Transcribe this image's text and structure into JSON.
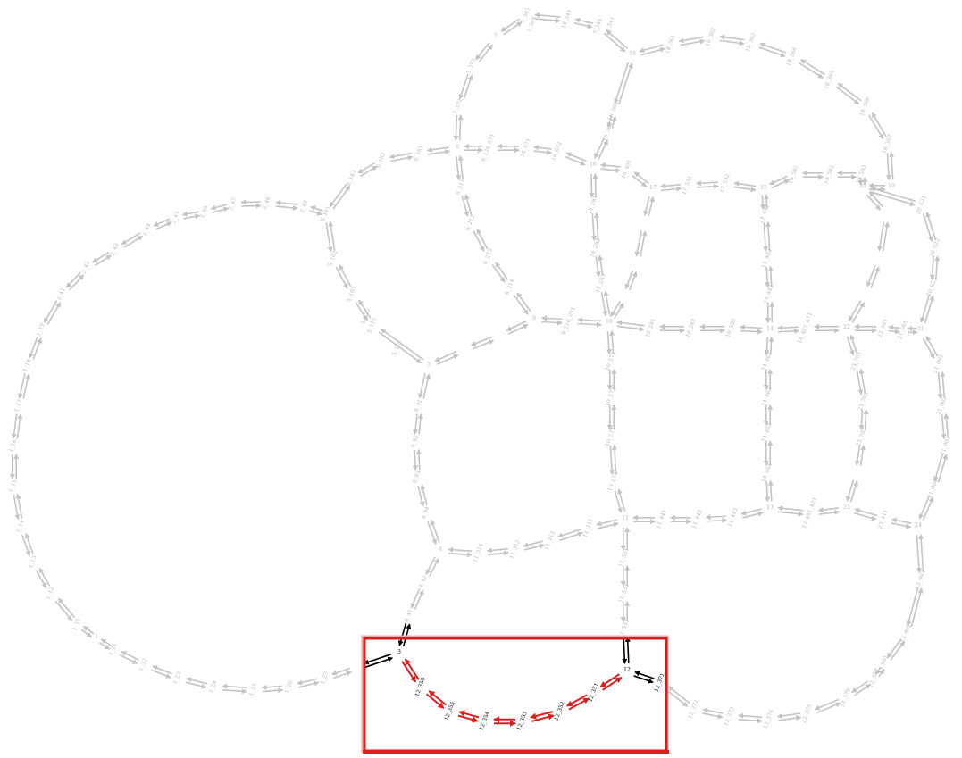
{
  "colors": {
    "inactive": "#c4c4c4",
    "active": "#000000",
    "highlight": "#dd1c1c"
  },
  "highlight_region": {
    "nodes": [
      "3",
      "12_356",
      "12_355",
      "12_354",
      "12_353",
      "12_352",
      "12_351",
      "12"
    ],
    "red_edges": [
      [
        "3",
        "12_356"
      ],
      [
        "12_356",
        "12_355"
      ],
      [
        "12_355",
        "12_354"
      ],
      [
        "12_354",
        "12_353"
      ],
      [
        "12_353",
        "12_352"
      ],
      [
        "12_352",
        "12_351"
      ],
      [
        "12_351",
        "12"
      ]
    ],
    "black_edges": [
      [
        "2_1",
        "3"
      ],
      [
        "3",
        "3_41"
      ],
      [
        "12",
        "12_331"
      ],
      [
        "12",
        "12_371"
      ]
    ]
  },
  "labels": {
    "grey": [
      "7_345",
      "7_346",
      "7_344",
      "7",
      "18_342",
      "18_341",
      "18",
      "18_361",
      "18_362",
      "18_363",
      "18_364",
      "18_365",
      "18_366",
      "18_367",
      "19",
      "7_373",
      "7_372",
      "6",
      "6_126_671",
      "16_671",
      "16_672",
      "16",
      "16_362",
      "16_361",
      "16_401",
      "17",
      "17_3",
      "17_531",
      "17_532",
      "15",
      "19_581",
      "19_582",
      "19_583",
      "19_584",
      "20",
      "20_621",
      "20_622",
      "20_623",
      "21",
      "6_161",
      "6_162",
      "6_163",
      "6_211",
      "6_212",
      "6_213",
      "6_214",
      "9",
      "9_216_291",
      "10",
      "10_281",
      "10_282",
      "10_283",
      "14",
      "14_481_671",
      "22",
      "22_601",
      "21_601",
      "21_001",
      "21_002",
      "21_003",
      "21_004",
      "24",
      "5_101",
      "5_102",
      "5_103",
      "5_111",
      "5",
      "5_121",
      "5_122",
      "6_181",
      "6_182",
      "6_183",
      "2_49",
      "2_48",
      "2_47",
      "2_46",
      "2_45",
      "2_44",
      "2_43",
      "2_42",
      "2_41",
      "1_19",
      "1_18",
      "1_17",
      "1_16",
      "1_15",
      "1_14",
      "1_13",
      "1_12",
      "1_11",
      "1",
      "1_21",
      "1_22",
      "1_23",
      "1_24",
      "1_25",
      "1_26",
      "1_27",
      "4_91",
      "4_92",
      "4_93",
      "4_94",
      "4",
      "4_41",
      "4_42",
      "11_314",
      "11_313",
      "11_312",
      "11_311",
      "11",
      "11_371",
      "11_372",
      "11_373",
      "11_374",
      "11_441",
      "11_442",
      "11_443",
      "11_451",
      "14_461",
      "14_462",
      "14_463",
      "14_464",
      "13",
      "13_481_421",
      "13_421",
      "13_422",
      "23",
      "23_411",
      "23_412",
      "23_413",
      "23_701",
      "23_702",
      "23_703",
      "16_281",
      "16_282",
      "16_283",
      "16_284",
      "10_271",
      "10_272",
      "10_273",
      "10_274",
      "11_331",
      "11_332",
      "11_333",
      "12_372",
      "12_373",
      "12_374",
      "12_375",
      "12_376",
      "12_377",
      "13_901",
      "13_902",
      "13_903",
      "15_481",
      "15_482",
      "15_483",
      "15_484"
    ],
    "dark": [
      "3",
      "12_356",
      "12_355",
      "12_354",
      "12_353",
      "12_352",
      "12_351",
      "12",
      "12_371"
    ]
  }
}
